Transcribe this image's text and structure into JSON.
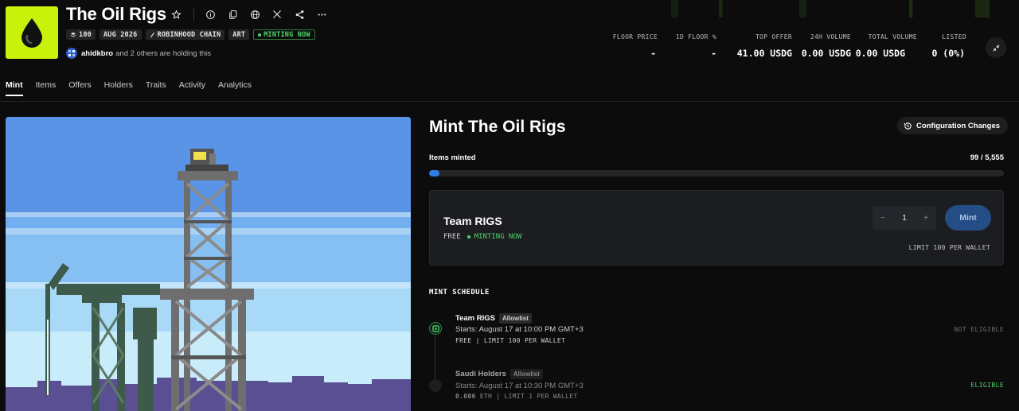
{
  "collection": {
    "title": "The Oil Rigs",
    "badges": [
      {
        "label": "100",
        "icon": "layers-icon"
      },
      {
        "label": "AUG 2026"
      },
      {
        "label": "ROBINHOOD CHAIN",
        "icon": "feather-icon"
      },
      {
        "label": "ART"
      },
      {
        "label": "MINTING NOW"
      }
    ],
    "holders": {
      "user": "ahidkbro",
      "text": "and 2 others are holding this"
    }
  },
  "stats": [
    {
      "label": "FLOOR PRICE",
      "value": "-"
    },
    {
      "label": "1D FLOOR %",
      "value": "-"
    },
    {
      "label": "TOP OFFER",
      "value": "41.00 USDG"
    },
    {
      "label": "24H VOLUME",
      "value": "0.00 USDG"
    },
    {
      "label": "TOTAL VOLUME",
      "value": "0.00 USDG"
    },
    {
      "label": "LISTED",
      "value": "0 (0%)"
    }
  ],
  "tabs": [
    "Mint",
    "Items",
    "Offers",
    "Holders",
    "Traits",
    "Activity",
    "Analytics"
  ],
  "mint": {
    "title": "Mint The Oil Rigs",
    "config_label": "Configuration Changes",
    "progress_label": "Items minted",
    "progress_value": "99 / 5,555",
    "progress_fraction": 0.0178,
    "card": {
      "name": "Team RIGS",
      "price": "FREE",
      "status": "MINTING NOW",
      "qty": "1",
      "minus": "−",
      "plus": "+",
      "button": "Mint",
      "limit": "LIMIT 100 PER WALLET"
    },
    "schedule_title": "MINT SCHEDULE",
    "schedule": [
      {
        "name": "Team RIGS",
        "tag": "Allowlist",
        "start": "Starts: August 17 at 10:00 PM GMT+3",
        "price": "FREE | LIMIT 100 PER WALLET",
        "status": "NOT ELIGIBLE"
      },
      {
        "name": "Saudi Holders",
        "tag": "Allowlist",
        "start": "Starts: August 17 at 10:30 PM GMT+3",
        "price_amount": "0.006",
        "price": "ETH | LIMIT 1 PER WALLET",
        "status": "ELIGIBLE"
      }
    ]
  },
  "colors": {
    "accent": "#c9f20a",
    "minting": "#4ed66a",
    "progress": "#2f7ee8"
  }
}
